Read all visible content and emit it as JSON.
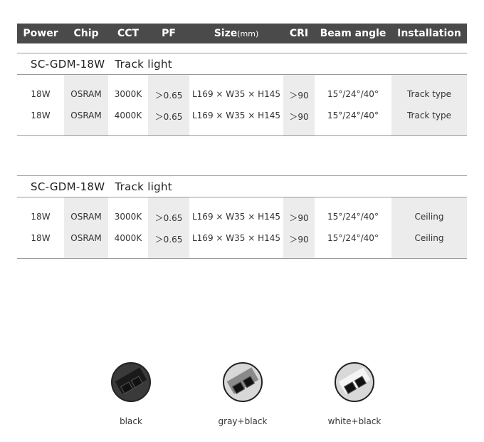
{
  "header": {
    "columns": [
      "Power",
      "Chip",
      "CCT",
      "PF",
      "Size",
      "CRI",
      "Beam angle",
      "Installation"
    ],
    "size_unit": "(mm)"
  },
  "sections": [
    {
      "model": "SC-GDM-18W",
      "type": "Track light",
      "rows": [
        [
          "18W",
          "OSRAM",
          "3000K",
          "＞0.65",
          "L169 × W35 × H145",
          "＞90",
          "15°/24°/40°",
          "Track type"
        ],
        [
          "18W",
          "OSRAM",
          "4000K",
          "＞0.65",
          "L169 × W35 × H145",
          "＞90",
          "15°/24°/40°",
          "Track type"
        ]
      ]
    },
    {
      "model": "SC-GDM-18W",
      "type": "Track light",
      "rows": [
        [
          "18W",
          "OSRAM",
          "3000K",
          "＞0.65",
          "L169 × W35 × H145",
          "＞90",
          "15°/24°/40°",
          "Ceiling"
        ],
        [
          "18W",
          "OSRAM",
          "4000K",
          "＞0.65",
          "L169 × W35 × H145",
          "＞90",
          "15°/24°/40°",
          "Ceiling"
        ]
      ]
    }
  ],
  "finishes": [
    {
      "label": "black",
      "body_color": "#1a1a1a",
      "accent_color": "#1a1a1a"
    },
    {
      "label": "gray+black",
      "body_color": "#8a8a8a",
      "accent_color": "#1a1a1a"
    },
    {
      "label": "white+black",
      "body_color": "#f4f4f4",
      "accent_color": "#1a1a1a"
    }
  ],
  "colors": {
    "header_bg": "#4a4a4a",
    "shaded_column": "#ececec",
    "rule": "#9a9a9a"
  }
}
